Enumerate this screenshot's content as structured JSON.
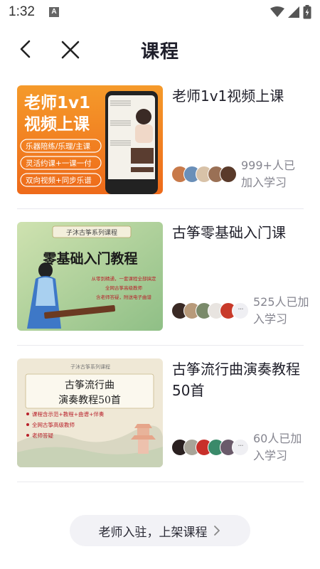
{
  "status_bar": {
    "time": "1:32",
    "notification_icon": "A"
  },
  "header": {
    "title": "课程"
  },
  "courses": [
    {
      "title": "老师1v1视频上课",
      "learners": "999+人已加入学习",
      "thumbnail": {
        "headline_1": "老师1v1",
        "headline_2": "视频上课",
        "tags": [
          "乐器陪练/乐理/主课",
          "灵活约课+一课一付",
          "双向视频+同步乐谱"
        ]
      }
    },
    {
      "title": "古筝零基础入门课",
      "learners": "525人已加入学习",
      "thumbnail": {
        "top": "子沐古筝系列课程",
        "headline": "零基础入门教程",
        "lines": [
          "从零到精通，一套课程全部搞定",
          "全网古筝高级教师",
          "含老师答疑，附送电子曲谱"
        ]
      }
    },
    {
      "title": "古筝流行曲演奏教程50首",
      "learners": "60人已加入学习",
      "thumbnail": {
        "top": "子沐古筝系列课程",
        "headline_1": "古筝流行曲",
        "headline_2": "演奏教程50首",
        "bullets": [
          "课程含示范+教程+曲谱+伴奏",
          "全网古筝高级教师",
          "老师答疑"
        ]
      }
    }
  ],
  "cta": {
    "label": "老师入驻，上架课程"
  },
  "colors": {
    "accent_orange": "#f27a1f",
    "title_text": "#1f1f2a",
    "muted_text": "#85858f",
    "cta_bg": "#f2f2f6"
  }
}
